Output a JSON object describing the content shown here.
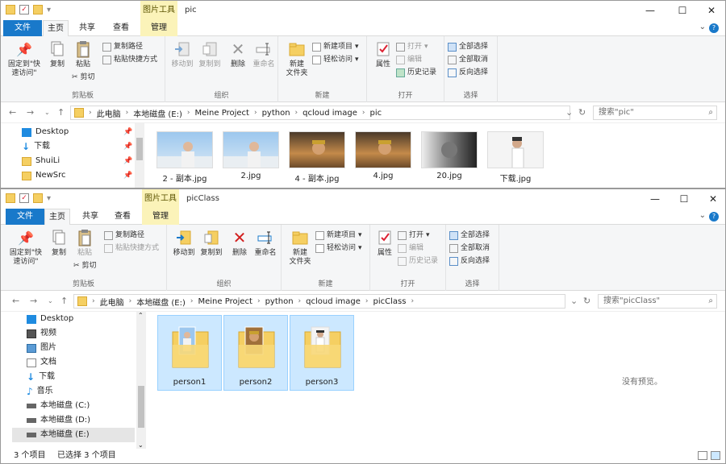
{
  "window1": {
    "title": "pic",
    "context_tab": "图片工具",
    "tabs": [
      "文件",
      "主页",
      "共享",
      "查看",
      "管理"
    ],
    "ribbon": {
      "clipboard": {
        "label": "剪贴板",
        "pin": "固定到\"快\n速访问\"",
        "copy": "复制",
        "paste": "粘贴",
        "copy_path": "复制路径",
        "paste_shortcut": "粘贴快捷方式",
        "cut": "剪切"
      },
      "organize": {
        "label": "组织",
        "move_to": "移动到",
        "copy_to": "复制到",
        "delete": "删除",
        "rename": "重命名"
      },
      "new": {
        "label": "新建",
        "new_folder": "新建\n文件夹",
        "new_item": "新建项目",
        "easy_access": "轻松访问"
      },
      "open": {
        "label": "打开",
        "properties": "属性",
        "open": "打开",
        "edit": "编辑",
        "history": "历史记录"
      },
      "select": {
        "label": "选择",
        "select_all": "全部选择",
        "select_none": "全部取消",
        "invert": "反向选择"
      }
    },
    "address": {
      "crumbs": [
        "此电脑",
        "本地磁盘 (E:)",
        "Meine Project",
        "python",
        "qcloud image",
        "pic"
      ],
      "search_placeholder": "搜索\"pic\""
    },
    "nav": [
      {
        "label": "Desktop",
        "icon": "desktop-icon",
        "pinned": true
      },
      {
        "label": "下载",
        "icon": "download-arrow-icon",
        "pinned": true
      },
      {
        "label": "ShuiLi",
        "icon": "folder-icon",
        "pinned": true
      },
      {
        "label": "NewSrc",
        "icon": "folder-icon",
        "pinned": true
      }
    ],
    "files": [
      "2 - 副本.jpg",
      "2.jpg",
      "4 - 副本.jpg",
      "4.jpg",
      "20.jpg",
      "下载.jpg"
    ]
  },
  "window2": {
    "title": "picClass",
    "context_tab": "图片工具",
    "tabs": [
      "文件",
      "主页",
      "共享",
      "查看",
      "管理"
    ],
    "ribbon": {
      "clipboard": {
        "label": "剪贴板",
        "pin": "固定到\"快\n速访问\"",
        "copy": "复制",
        "paste": "粘贴",
        "copy_path": "复制路径",
        "paste_shortcut": "粘贴快捷方式",
        "cut": "剪切"
      },
      "organize": {
        "label": "组织",
        "move_to": "移动到",
        "copy_to": "复制到",
        "delete": "删除",
        "rename": "重命名"
      },
      "new": {
        "label": "新建",
        "new_folder": "新建\n文件夹",
        "new_item": "新建项目",
        "easy_access": "轻松访问"
      },
      "open": {
        "label": "打开",
        "properties": "属性",
        "open": "打开",
        "edit": "编辑",
        "history": "历史记录"
      },
      "select": {
        "label": "选择",
        "select_all": "全部选择",
        "select_none": "全部取消",
        "invert": "反向选择"
      }
    },
    "address": {
      "crumbs": [
        "此电脑",
        "本地磁盘 (E:)",
        "Meine Project",
        "python",
        "qcloud image",
        "picClass"
      ],
      "search_placeholder": "搜索\"picClass\""
    },
    "nav": [
      {
        "label": "Desktop",
        "icon": "desktop-icon"
      },
      {
        "label": "视频",
        "icon": "video-icon"
      },
      {
        "label": "图片",
        "icon": "pictures-icon"
      },
      {
        "label": "文档",
        "icon": "documents-icon"
      },
      {
        "label": "下载",
        "icon": "download-arrow-icon"
      },
      {
        "label": "音乐",
        "icon": "music-note-icon"
      },
      {
        "label": "本地磁盘 (C:)",
        "icon": "drive-icon"
      },
      {
        "label": "本地磁盘 (D:)",
        "icon": "drive-icon"
      },
      {
        "label": "本地磁盘 (E:)",
        "icon": "drive-icon",
        "selected": true
      }
    ],
    "folders": [
      "person1",
      "person2",
      "person3"
    ],
    "preview_text": "没有预览。",
    "status": {
      "count": "3 个项目",
      "selected": "已选择 3 个项目"
    }
  },
  "colors": {
    "accent": "#1979ca",
    "context_tab": "#fbf3b9",
    "selection": "#cce8ff",
    "folder": "#f5cf62"
  }
}
